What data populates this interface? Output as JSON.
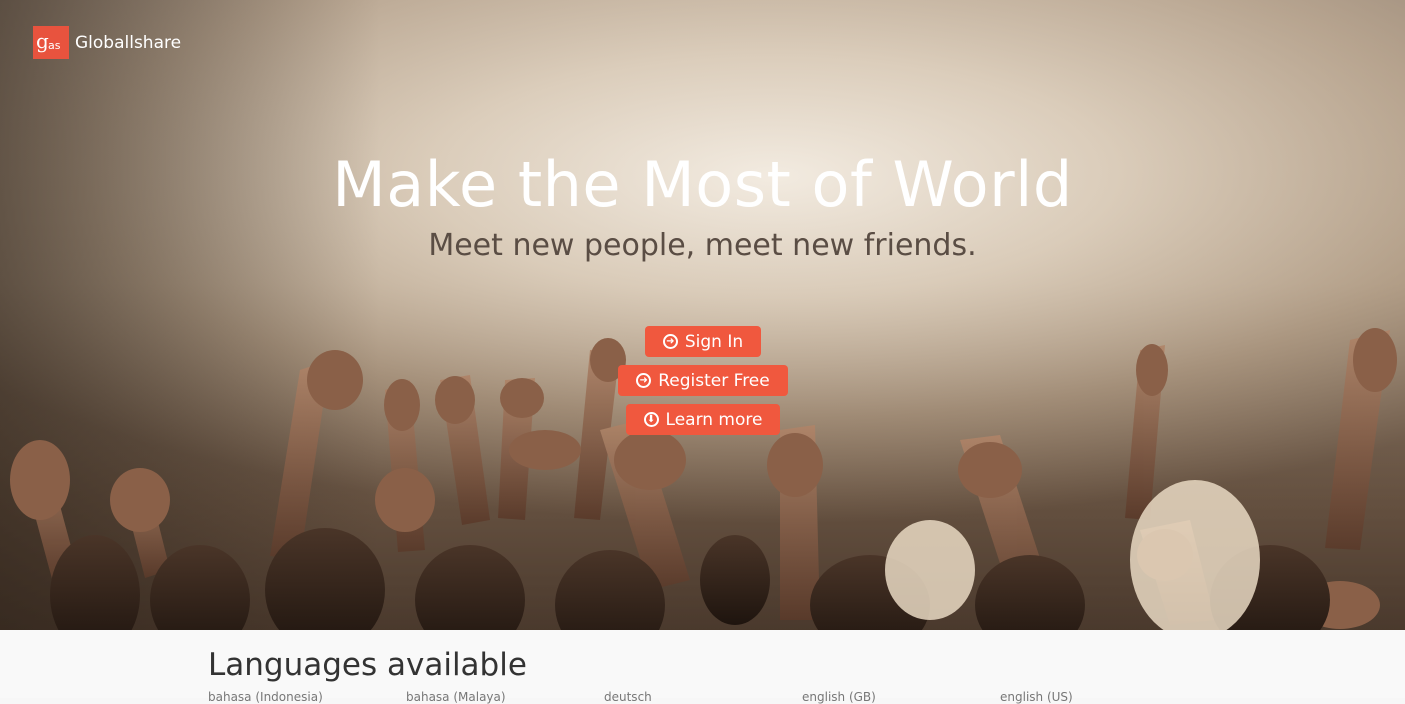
{
  "brand": {
    "logo_mark": "g",
    "logo_sub": "as",
    "name": "Globallshare",
    "accent": "#f0583e"
  },
  "hero": {
    "title": "Make the Most of World",
    "subtitle": "Meet new people, meet new friends.",
    "buttons": [
      {
        "label": "Sign In",
        "icon": "arrow-circle-right-icon"
      },
      {
        "label": "Register Free",
        "icon": "arrow-circle-right-icon"
      },
      {
        "label": "Learn more",
        "icon": "arrow-circle-down-icon"
      }
    ]
  },
  "languages": {
    "title": "Languages available",
    "items": [
      "bahasa (Indonesia)",
      "bahasa (Malaya)",
      "deutsch",
      "english (GB)",
      "english (US)"
    ]
  }
}
